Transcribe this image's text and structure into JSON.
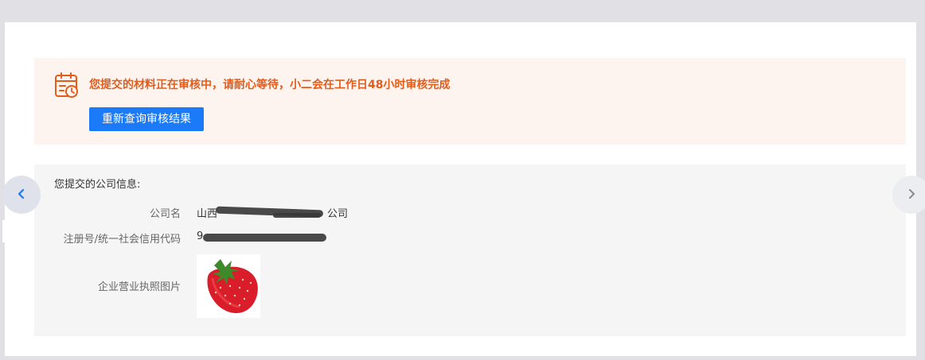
{
  "notice": {
    "icon": "calendar-clock-icon",
    "message": "您提交的材料正在审核中，请耐心等待，小二会在工作日48小时审核完成",
    "recheck_button": "重新查询审核结果",
    "accent_color": "#e35d1a",
    "button_color": "#1a7af8"
  },
  "company_info": {
    "title": "您提交的公司信息:",
    "rows": [
      {
        "label": "公司名",
        "value": "山西",
        "value_tail": "公司",
        "redacted": true
      },
      {
        "label": "注册号/统一社会信用代码",
        "value": "9",
        "redacted": true
      },
      {
        "label": "企业营业执照图片",
        "image": "strawberry-image"
      }
    ]
  },
  "navigation": {
    "prev_icon": "chevron-left-icon",
    "next_icon": "chevron-right-icon"
  }
}
